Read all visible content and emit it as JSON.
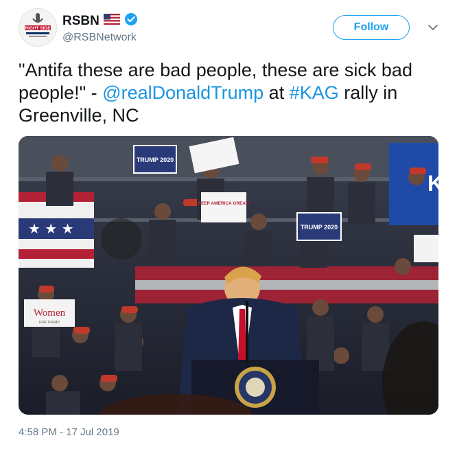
{
  "account": {
    "display_name": "RSBN",
    "handle": "@RSBNetwork",
    "verified": true,
    "avatar_text": "RIGHT SIDE"
  },
  "follow_label": "Follow",
  "tweet": {
    "part1": "\"Antifa these are bad people, these are sick bad people!\" - ",
    "mention": "@realDonaldTrump",
    "part2": " at ",
    "hashtag": "#KAG",
    "part3": " rally in Greenville, NC"
  },
  "media_signs": {
    "trump_2020": "TRUMP 2020",
    "keep_america_great": "KEEP AMERICA GREAT!",
    "women_for_trump": "Women",
    "women_sub": "FOR TRUMP"
  },
  "timestamp": "4:58 PM - 17 Jul 2019",
  "colors": {
    "link": "#1b95e0",
    "follow": "#1da1f2",
    "verified": "#1da1f2",
    "muted": "#657786"
  }
}
